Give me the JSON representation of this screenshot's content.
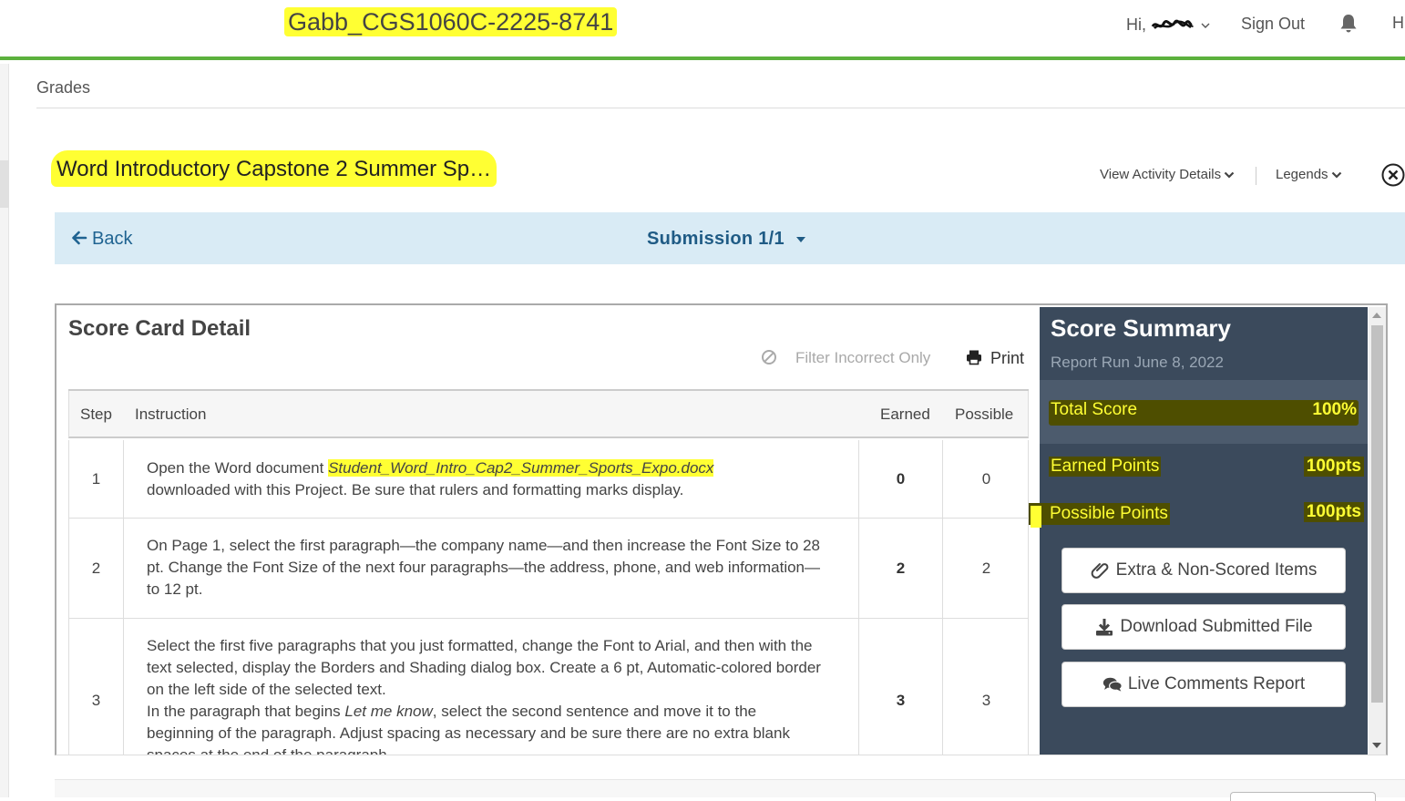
{
  "header": {
    "course_title": "Gabb_CGS1060C-2225-8741",
    "greeting": "Hi,",
    "sign_out": "Sign Out",
    "h_letter": "H"
  },
  "breadcrumb": {
    "grades": "Grades"
  },
  "activity": {
    "title": "Word Introductory Capstone 2 Summer Sp…",
    "view_details": "View Activity Details",
    "legends": "Legends"
  },
  "submission_bar": {
    "back": "Back",
    "submission": "Submission 1/1"
  },
  "score_card": {
    "title": "Score Card Detail",
    "filter": "Filter Incorrect Only",
    "print": "Print",
    "columns": {
      "step": "Step",
      "instruction": "Instruction",
      "earned": "Earned",
      "possible": "Possible"
    },
    "rows": [
      {
        "step": "1",
        "instr_a": "Open the Word document ",
        "instr_file": "Student_Word_Intro_Cap2_Summer_Sports_Expo.docx",
        "instr_b": "downloaded with this Project. Be sure that rulers and formatting marks display.",
        "earned": "0",
        "possible": "0"
      },
      {
        "step": "2",
        "instr_a": "On Page 1, select the first paragraph—the company name—and then increase the Font Size to 28 pt. Change the Font Size of the next four paragraphs—the address, phone, and web information—to 12 pt.",
        "earned": "2",
        "possible": "2"
      },
      {
        "step": "3",
        "instr_a": "Select the first five paragraphs that you just formatted, change the Font to Arial, and then with the text selected, display the Borders and Shading dialog box. Create a 6 pt, Automatic-colored border on the left side of the selected text.",
        "instr_b": "In the paragraph that begins ",
        "instr_italic": "Let me know",
        "instr_c": ", select the second sentence and move it to the beginning of the paragraph. Adjust spacing as necessary and be sure there are no extra blank spaces at the end of the paragraph.",
        "earned": "3",
        "possible": "3"
      }
    ]
  },
  "summary": {
    "title": "Score Summary",
    "report_run": "Report Run June 8, 2022",
    "total_label": "Total Score",
    "total_value": "100%",
    "earned_label": "Earned Points",
    "earned_value": "100pts",
    "possible_label": "Possible Points",
    "possible_value": "100pts",
    "btn_extra": "Extra & Non-Scored Items",
    "btn_download": "Download Submitted File",
    "btn_comments": "Live Comments Report"
  },
  "colors": {
    "brand_green": "#5cb13d",
    "highlight_yellow": "#ffff33",
    "summary_bg": "#3b4a5c",
    "submission_bar_bg": "#d9ebf5",
    "link_blue": "#1f6391"
  }
}
